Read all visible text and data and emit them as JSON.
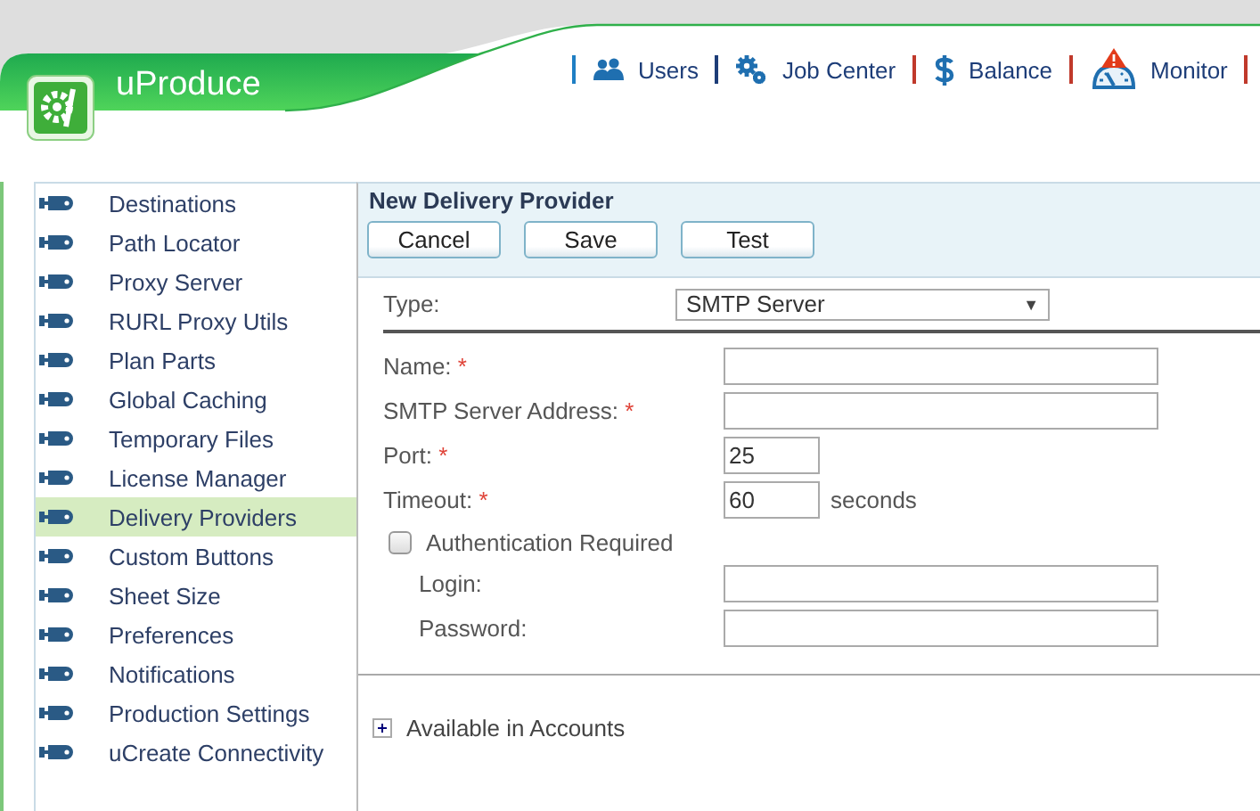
{
  "app": {
    "title": "uProduce"
  },
  "nav": [
    {
      "label": "Users"
    },
    {
      "label": "Job Center"
    },
    {
      "label": "Balance"
    },
    {
      "label": "Monitor"
    }
  ],
  "sidebar": {
    "items": [
      {
        "label": "Destinations",
        "selected": false
      },
      {
        "label": "Path Locator",
        "selected": false
      },
      {
        "label": "Proxy Server",
        "selected": false
      },
      {
        "label": "RURL Proxy Utils",
        "selected": false
      },
      {
        "label": "Plan Parts",
        "selected": false
      },
      {
        "label": "Global Caching",
        "selected": false
      },
      {
        "label": "Temporary Files",
        "selected": false
      },
      {
        "label": "License Manager",
        "selected": false
      },
      {
        "label": "Delivery Providers",
        "selected": true
      },
      {
        "label": "Custom Buttons",
        "selected": false
      },
      {
        "label": "Sheet Size",
        "selected": false
      },
      {
        "label": "Preferences",
        "selected": false
      },
      {
        "label": "Notifications",
        "selected": false
      },
      {
        "label": "Production Settings",
        "selected": false
      },
      {
        "label": "uCreate Connectivity",
        "selected": false
      }
    ]
  },
  "panel": {
    "title": "New Delivery Provider",
    "buttons": [
      "Cancel",
      "Save",
      "Test"
    ],
    "type": {
      "label": "Type:",
      "value": "SMTP Server",
      "caret": "▼"
    },
    "fields": [
      {
        "kind": "wide",
        "label": "Name:",
        "required": true
      },
      {
        "kind": "wide",
        "label": "SMTP Server Address:",
        "required": true
      },
      {
        "kind": "short",
        "label": "Port:",
        "required": true,
        "value": "25"
      },
      {
        "kind": "short",
        "label": "Timeout:",
        "required": true,
        "value": "60",
        "unit": "seconds"
      },
      {
        "kind": "checkbox",
        "label": "Authentication Required",
        "checked": false,
        "children": [
          {
            "kind": "wide",
            "label": "Login:",
            "required": false
          },
          {
            "kind": "wide",
            "label": "Password:",
            "required": false
          }
        ]
      }
    ],
    "required_mark": "*",
    "expander": {
      "label": "Available in Accounts",
      "expanded": false
    }
  }
}
